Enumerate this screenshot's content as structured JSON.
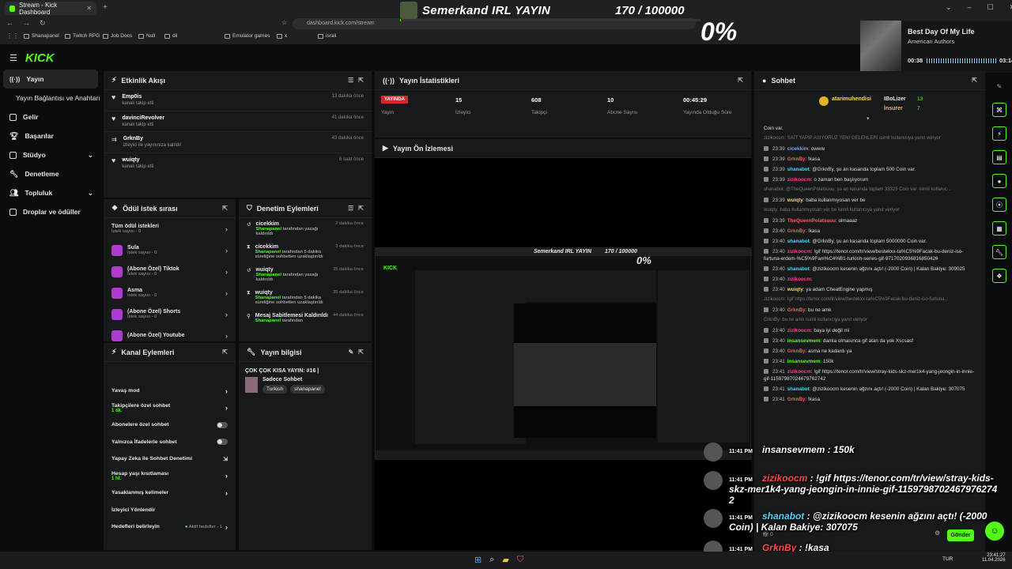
{
  "browser": {
    "tab_title": "Stream - Kick Dashboard",
    "url": "dashboard.kick.com/stream",
    "bookmarks": [
      "Shanapanel",
      "Twitch RPG",
      "Job Docs",
      "Null",
      "dil",
      "Emulator games",
      "x",
      "israil"
    ]
  },
  "overlay": {
    "title": "Semerkand IRL YAYIN",
    "goal": "170 / 100000",
    "percent": "0%"
  },
  "now_playing": {
    "song": "Best Day Of My Life",
    "artist": "American Authors",
    "elapsed": "00:38",
    "total": "03:14"
  },
  "sidebar": {
    "logo": "KICK",
    "items": [
      {
        "label": "Yayın"
      },
      {
        "label": "Yayın Bağlantısı ve Anahtarı"
      },
      {
        "label": "Gelir"
      },
      {
        "label": "Başarılar"
      },
      {
        "label": "Stüdyo"
      },
      {
        "label": "Denetleme"
      },
      {
        "label": "Topluluk"
      },
      {
        "label": "Droplar ve ödüller"
      }
    ]
  },
  "activity": {
    "title": "Etkinlik Akışı",
    "events": [
      {
        "name": "Emp0is",
        "sub": "kanalı takip etti",
        "time": "13 dakika önce"
      },
      {
        "name": "davinciRevolver",
        "sub": "kanalı takip etti",
        "time": "41 dakika önce"
      },
      {
        "name": "GrknBy",
        "sub": "izleyici ile yayınınıza katıldı!",
        "time": "43 dakika önce"
      },
      {
        "name": "wuiqty",
        "sub": "kanalı takip etti",
        "time": "6 saat önce"
      }
    ]
  },
  "stats": {
    "title": "Yayın İstatistikleri",
    "live_badge": "YAYINDA",
    "live_label": "Yayın",
    "items": [
      {
        "value": "15",
        "label": "İzleyici"
      },
      {
        "value": "608",
        "label": "Takipçi"
      },
      {
        "value": "10",
        "label": "Abone Sayısı"
      },
      {
        "value": "00:45:29",
        "label": "Yayında Olduğu Süre"
      }
    ]
  },
  "preview": {
    "title": "Yayın Ön İzlemesi"
  },
  "rewards": {
    "title": "Ödül istek sırası",
    "items": [
      {
        "name": "Tüm ödül istekleri",
        "sub": "İstek sayısı - 0"
      },
      {
        "name": "Sula",
        "sub": "İstek sayısı - 0"
      },
      {
        "name": "(Abone Özel) Tiktok",
        "sub": "İstek sayısı - 0"
      },
      {
        "name": "Asma",
        "sub": "İstek sayısı - 0"
      },
      {
        "name": "(Abone Özel) Shorts",
        "sub": "İstek sayısı - 0"
      },
      {
        "name": "(Abone Özel) Youtube",
        "sub": ""
      }
    ]
  },
  "modlog": {
    "title": "Denetim Eylemleri",
    "items": [
      {
        "name": "cicekkim",
        "by": "Shanapanel",
        "text": "tarafından yasağı kaldırıldı",
        "time": "2 dakika önce"
      },
      {
        "name": "cicekkim",
        "by": "Shanapanel",
        "text": "tarafından 5 dakika süreliğine sohbetten uzaklaştırıldı",
        "time": "3 dakika önce"
      },
      {
        "name": "wuiqty",
        "by": "Shanapanel",
        "text": "tarafından yasağı kaldırıldı",
        "time": "35 dakika önce"
      },
      {
        "name": "wuiqty",
        "by": "Shanapanel",
        "text": "tarafından 5 dakika süreliğine sohbetten uzaklaştırıldı",
        "time": "35 dakika önce"
      },
      {
        "name": "Mesaj Sabitlemesi Kaldırıldı",
        "by": "Shanapanel",
        "text": "tarafından",
        "time": "44 dakika önce"
      }
    ]
  },
  "channel": {
    "title": "Kanal Eylemleri",
    "items": [
      {
        "label": "Yavaş mod",
        "sub": ""
      },
      {
        "label": "Takipçilere özel sohbet",
        "sub": "1 dk."
      },
      {
        "label": "Abonelere özel sohbet",
        "sub": ""
      },
      {
        "label": "Yalnızca İfadelerle sohbet",
        "sub": ""
      },
      {
        "label": "Yapay Zeka ile Sohbet Denetimi",
        "sub": ""
      },
      {
        "label": "Hesap yaşı kısıtlaması",
        "sub": "1 hf."
      },
      {
        "label": "Yasaklanmış kelimeler",
        "sub": ""
      },
      {
        "label": "İzleyici Yönlendir",
        "sub": ""
      },
      {
        "label": "Hedefleri belirleyin",
        "sub": "Aktif hedefler - 1"
      }
    ]
  },
  "streaminfo": {
    "title": "Yayın bilgisi",
    "stream_title": "ÇOK ÇOK KISA YAYIN: #16 |",
    "category": "Sadece Sohbet",
    "tags": [
      "Turkish",
      "shanapanel"
    ]
  },
  "chat": {
    "title": "Sohbet",
    "top_gifters": [
      {
        "name": "atarimuhendisi"
      },
      {
        "name": "IBoLizer",
        "count": "13"
      },
      {
        "name": "İnsurer",
        "count": "7"
      }
    ],
    "lines": [
      {
        "sys": false,
        "time": "",
        "user": "",
        "color": "#ddd",
        "text": "Coin var."
      },
      {
        "sys": true,
        "text": "zizikoocm: SAİT YAPIP ASIYORUZ YENİ GELENLERİ isimli kullanıcıya yanıt veriyor"
      },
      {
        "sys": false,
        "time": "23:39",
        "user": "cicekkim",
        "color": "#6fa8ff",
        "text": "owww"
      },
      {
        "sys": false,
        "time": "23:39",
        "user": "GrknBy",
        "color": "#ff5a5a",
        "text": "!kasa"
      },
      {
        "sys": false,
        "time": "23:39",
        "user": "shanabot",
        "color": "#4fd3ff",
        "text": "@GrknBy, şu an kasanda toplam 500 Coin var."
      },
      {
        "sys": false,
        "time": "23:39",
        "user": "zizikoocm",
        "color": "#ff3b8d",
        "text": "o zaman ben başlıyorum"
      },
      {
        "sys": true,
        "text": "shanabot: @TheQueenPolatsuuu, şu an kasanda toplam 33325 Coin var. isimli kullanıc..."
      },
      {
        "sys": false,
        "time": "23:39",
        "user": "wuiqty",
        "color": "#ffd84f",
        "text": "baba kullanmıyosan ver be"
      },
      {
        "sys": true,
        "text": "wuiqty: baba kullanmıyosan ver be isimli kullanıcıya yanıt veriyor"
      },
      {
        "sys": false,
        "time": "23:39",
        "user": "TheQueenPolatsuuu",
        "color": "#ff5a5a",
        "text": "olmaaaz"
      },
      {
        "sys": false,
        "time": "23:40",
        "user": "GrknBy",
        "color": "#ff5a5a",
        "text": "!kasa"
      },
      {
        "sys": false,
        "time": "23:40",
        "user": "shanabot",
        "color": "#4fd3ff",
        "text": "@GrknBy, şu an kasanda toplam 5000000 Coin var."
      },
      {
        "sys": false,
        "time": "23:40",
        "user": "zizikoocm",
        "color": "#ff3b8d",
        "text": "!gif https://tenor.com/tr/view/bestekxx-ta%C5%9Facak-bu-deniz-iso-furtuna-erdem-%C5%9Fani%C4%B1-turkish-series-gif-9717020936816850426"
      },
      {
        "sys": false,
        "time": "23:40",
        "user": "shanabot",
        "color": "#4fd3ff",
        "text": "@zizikoocm kesenin ağzını açtı! (-2000 Coin) | Kalan Bakiye: 309025"
      },
      {
        "sys": false,
        "time": "23:40",
        "user": "zizikoocm",
        "color": "#ff3b8d",
        "text": ""
      },
      {
        "sys": false,
        "time": "23:40",
        "user": "wuiqty",
        "color": "#ffd84f",
        "text": "ya adam CheatEngine yapmış"
      },
      {
        "sys": true,
        "text": "zizikoocm: !gif https://tenor.com/tr/view/bestekxx-ta%C5%9Facak-bu-deniz-iso-furtuna..."
      },
      {
        "sys": false,
        "time": "23:40",
        "user": "GrknBy",
        "color": "#ff5a5a",
        "text": "bu ne amk"
      },
      {
        "sys": true,
        "text": "GrknBy: bu ne amk isimli kullanıcıya yanıt veriyor"
      },
      {
        "sys": false,
        "time": "23:40",
        "user": "zizikoocm",
        "color": "#ff3b8d",
        "text": "baya iyi değil mi"
      },
      {
        "sys": false,
        "time": "23:40",
        "user": "insansevmem",
        "color": "#53fc18",
        "text": "damla olmasınca gif atan da yok Xscsasf"
      },
      {
        "sys": false,
        "time": "23:40",
        "user": "GrknBy",
        "color": "#ff5a5a",
        "text": "asma ne kadardı ya"
      },
      {
        "sys": false,
        "time": "23:41",
        "user": "insansevmem",
        "color": "#53fc18",
        "text": "150k"
      },
      {
        "sys": false,
        "time": "23:41",
        "user": "zizikoocm",
        "color": "#ff3b8d",
        "text": "!gif https://tenor.com/tr/view/stray-kids-skz-mer1k4-yang-jeongin-in-innie-gif-11597987024679762742"
      },
      {
        "sys": false,
        "time": "23:41",
        "user": "shanabot",
        "color": "#4fd3ff",
        "text": "@zizikoocm kesenin ağzını açtı! (-2000 Coin) | Kalan Bakiye: 307075"
      },
      {
        "sys": false,
        "time": "23:41",
        "user": "GrknBy",
        "color": "#ff5a5a",
        "text": "!kasa"
      }
    ],
    "pinned_partial": "arken ben",
    "pinned_partial2": "Hepsini Kaydır",
    "send_label": "Gönder",
    "count": "0"
  },
  "overlay_chat": [
    {
      "time": "11:41 PM",
      "user": "insansevmem",
      "text": "150k"
    },
    {
      "time": "11:41 PM",
      "user": "zizikoocm",
      "text": "!gif https://tenor.com/tr/view/stray-kids-skz-mer1k4-yang-jeongin-in-innie-gif-11597987024679762742"
    },
    {
      "time": "11:41 PM",
      "user": "shanabot",
      "text": "@zizikoocm kesenin ağzını açtı! (-2000 Coin) | Kalan Bakiye: 307075"
    },
    {
      "time": "11:41 PM",
      "user": "GrknBy",
      "text": "!kasa"
    }
  ],
  "taskbar": {
    "lang": "TUR",
    "time": "23:41:27",
    "date": "11.04.2026"
  },
  "colors": {
    "accent": "#53fc18",
    "live": "#d6262b"
  }
}
